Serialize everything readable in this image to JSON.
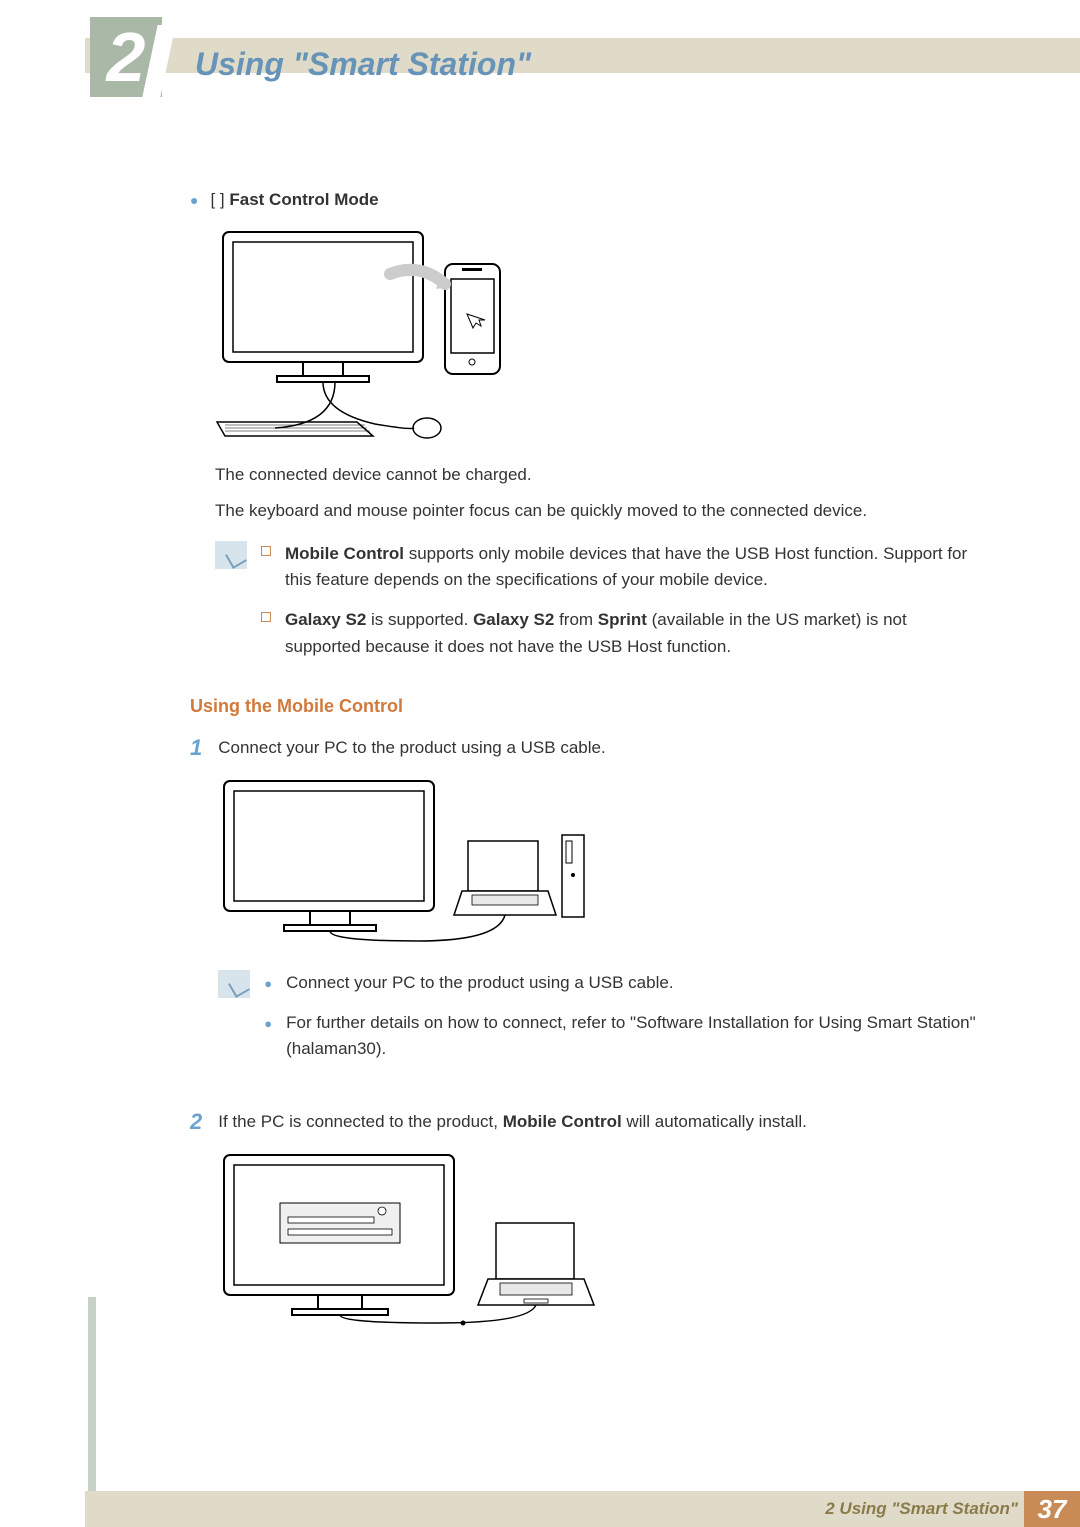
{
  "chapter": {
    "number": "2",
    "title": "Using \"Smart Station\""
  },
  "fast_control": {
    "label_prefix": "[     ] ",
    "label_bold": "Fast Control Mode",
    "desc1": "The connected device cannot be charged.",
    "desc2": "The keyboard and mouse pointer focus can be quickly moved to the connected device."
  },
  "notes1": {
    "item1_a": "Mobile Control",
    "item1_b": " supports only mobile devices that have the USB Host function. Support for this feature depends on the specifications of your mobile device.",
    "item2_a": "Galaxy S2",
    "item2_b": " is supported. ",
    "item2_c": "Galaxy S2",
    "item2_d": " from ",
    "item2_e": "Sprint",
    "item2_f": " (available in the US market) is not supported because it does not have the USB Host function."
  },
  "mobile_control": {
    "heading": "Using the Mobile Control",
    "step1_num": "1",
    "step1_text": "Connect your PC to the product using a USB cable.",
    "step1_note_a": "Connect your PC to the product using a USB cable.",
    "step1_note_b": "For further details on how to connect, refer to \"Software Installation for Using Smart Station\" (halaman30).",
    "step2_num": "2",
    "step2_text_a": "If the PC is connected to the product, ",
    "step2_text_b": "Mobile Control",
    "step2_text_c": " will automatically install."
  },
  "footer": {
    "text": "2 Using \"Smart Station\"",
    "page": "37"
  }
}
